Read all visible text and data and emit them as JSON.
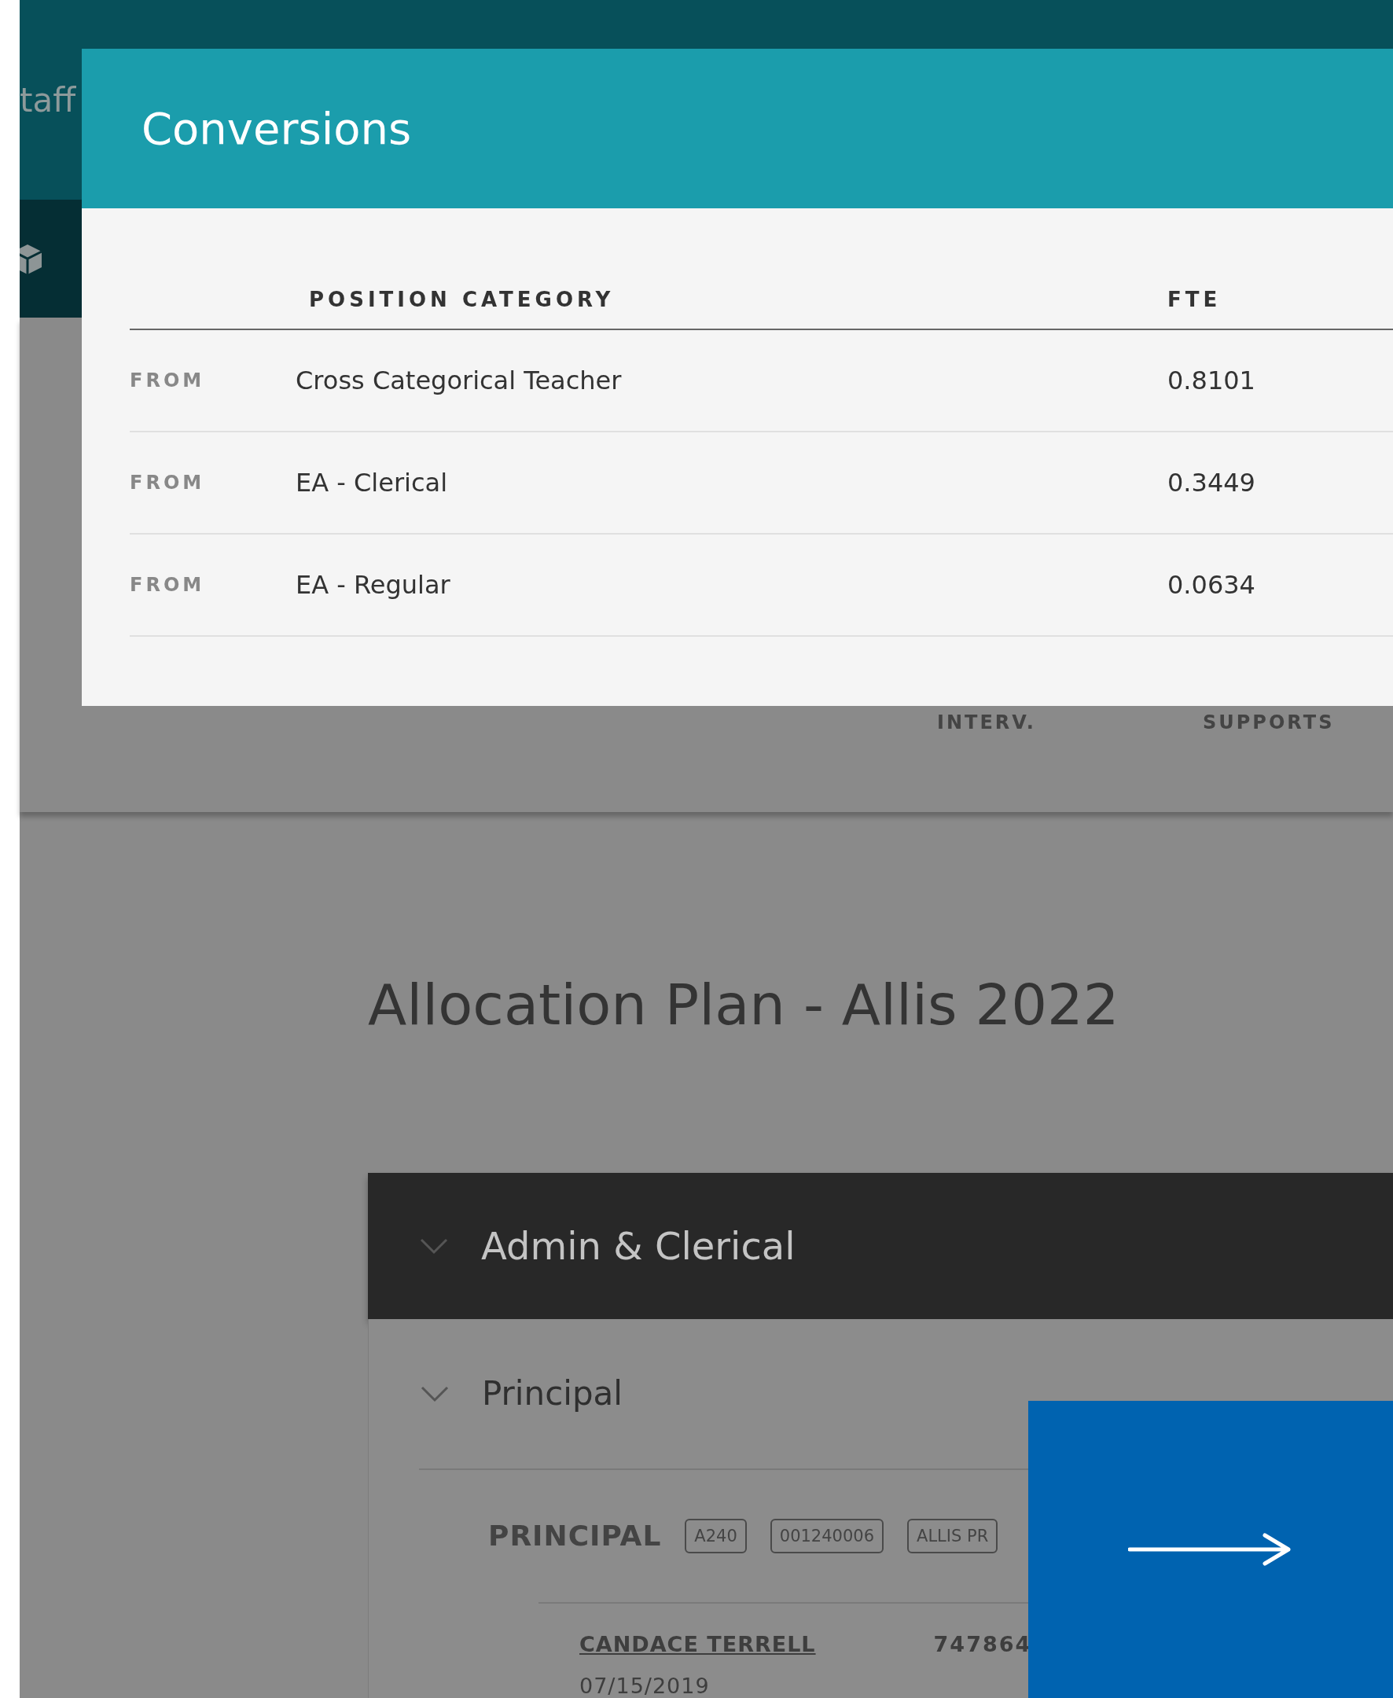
{
  "background": {
    "top_bar": {
      "title": "taff"
    },
    "panel_columns": [
      "INTERV.",
      "SUPPORTS"
    ],
    "plan_title": "Allocation Plan - Allis 2022",
    "sections": [
      {
        "title": "Admin & Clerical",
        "expanded": true,
        "groups": [
          {
            "title": "Principal",
            "expanded": true,
            "positions": [
              {
                "title": "PRINCIPAL",
                "tags": [
                  "A240",
                  "001240006",
                  "ALLIS PR"
                ],
                "staff": [
                  {
                    "name": "CANDACE TERRELL",
                    "id": "747864",
                    "date": "07/15/2019"
                  }
                ]
              }
            ]
          }
        ]
      }
    ]
  },
  "dialog": {
    "title": "Conversions",
    "columns": [
      "POSITION CATEGORY",
      "FTE"
    ],
    "rows": [
      {
        "direction": "FROM",
        "category": "Cross Categorical Teacher",
        "fte": "0.8101"
      },
      {
        "direction": "FROM",
        "category": "EA - Clerical",
        "fte": "0.3449"
      },
      {
        "direction": "FROM",
        "category": "EA - Regular",
        "fte": "0.0634"
      }
    ]
  }
}
